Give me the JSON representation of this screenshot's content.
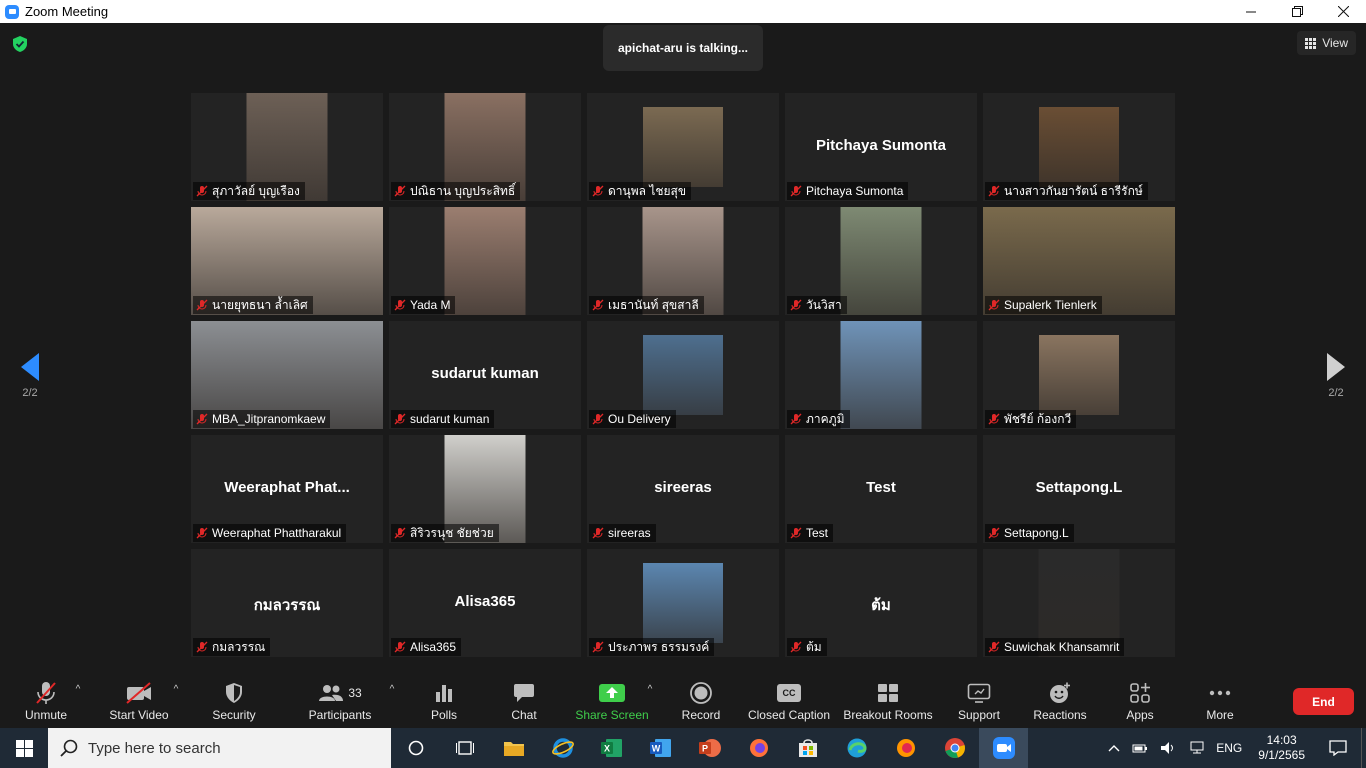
{
  "window": {
    "title": "Zoom Meeting",
    "controls": [
      "minimize",
      "maximize",
      "close"
    ]
  },
  "meeting": {
    "talking_indicator": "apichat-aru is talking...",
    "view_label": "View",
    "page_indicator": "2/2"
  },
  "participants": [
    {
      "name": "สุภาวัลย์ บุญเรือง",
      "video": "narrow",
      "bg": "#6d6056"
    },
    {
      "name": "ปณิธาน บุญประสิทธิ์",
      "video": "narrow",
      "bg": "#8a7062"
    },
    {
      "name": "ดานุพล ไชยสุข",
      "video": "small",
      "bg": "#7b6a52"
    },
    {
      "name": "Pitchaya Sumonta",
      "display": "Pitchaya Sumonta"
    },
    {
      "name": "นางสาวกันยารัตน์ ธารีรักษ์",
      "video": "small",
      "bg": "#6a4e34"
    },
    {
      "name": "นายยุทธนา ล้ำเลิศ",
      "video": "wide",
      "bg": "#b9a99b"
    },
    {
      "name": "Yada M",
      "video": "narrow",
      "bg": "#9b7e70"
    },
    {
      "name": "เมธานันท์ สุขสาลี",
      "video": "narrow",
      "bg": "#a8958b"
    },
    {
      "name": "วันวิสา",
      "video": "narrow",
      "bg": "#7e8a73"
    },
    {
      "name": "Supalerk Tienlerk",
      "video": "wide",
      "bg": "#7a6a4c"
    },
    {
      "name": "MBA_Jitpranomkaew",
      "video": "wide",
      "bg": "#8c8f93"
    },
    {
      "name": "sudarut kuman",
      "display": "sudarut kuman"
    },
    {
      "name": "Ou Delivery",
      "video": "small",
      "bg": "#4e6f8f"
    },
    {
      "name": "ภาคภูมิ",
      "video": "narrow",
      "bg": "#6f93b8"
    },
    {
      "name": "พัชรีย์ ก้องกวี",
      "video": "small",
      "bg": "#8a7560"
    },
    {
      "name": "Weeraphat Phattharakul",
      "display": "Weeraphat  Phat..."
    },
    {
      "name": "สิริวรนุช ชัยช่วย",
      "video": "narrow",
      "bg": "#d0cfcb"
    },
    {
      "name": "sireeras",
      "display": "sireeras"
    },
    {
      "name": "Test",
      "display": "Test"
    },
    {
      "name": "Settapong.L",
      "display": "Settapong.L"
    },
    {
      "name": "กมลวรรณ",
      "display": "กมลวรรณ"
    },
    {
      "name": "Alisa365",
      "display": "Alisa365"
    },
    {
      "name": "ประภาพร ธรรมรงค์",
      "video": "small",
      "bg": "#5b86b0"
    },
    {
      "name": "ต้ม",
      "display": "ต้ม"
    },
    {
      "name": "Suwichak Khansamrit",
      "video": "narrow",
      "bg": "#2a2a2a"
    }
  ],
  "toolbar": {
    "unmute": "Unmute",
    "start_video": "Start Video",
    "security": "Security",
    "participants": "Participants",
    "participants_count": "33",
    "polls": "Polls",
    "chat": "Chat",
    "share_screen": "Share Screen",
    "record": "Record",
    "closed_caption": "Closed Caption",
    "cc_icon_text": "CC",
    "breakout_rooms": "Breakout Rooms",
    "support": "Support",
    "reactions": "Reactions",
    "apps": "Apps",
    "more": "More",
    "end": "End"
  },
  "taskbar": {
    "search_placeholder": "Type here to search",
    "language": "ENG",
    "time": "14:03",
    "date": "9/1/2565"
  },
  "colors": {
    "share_green": "#3fce4b",
    "end_red": "#e02828",
    "security_shield": "#23d160"
  }
}
